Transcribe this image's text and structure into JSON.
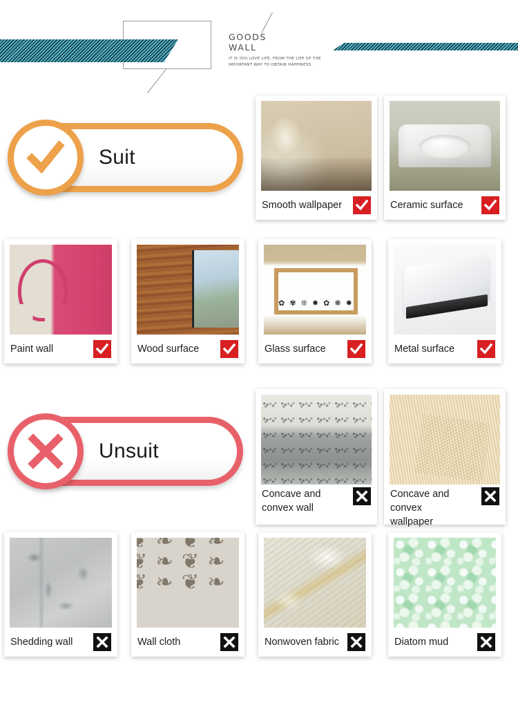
{
  "header": {
    "title_line1": "GOODS",
    "title_line2": "WALL",
    "subtitle": "IT IS YOU LOVE LIFE, FROM THE LIFE OF THE IMPORTANT WAY TO OBTAIN HAPPINESS.",
    "stripe_color": "#2b7f92"
  },
  "sections": [
    {
      "id": "suit",
      "label": "Suit",
      "icon": "check-icon",
      "accent": "#eda14a",
      "badge_type": "ok",
      "badge_glyph": "✔",
      "badge_color": "#d81f22"
    },
    {
      "id": "unsuit",
      "label": "Unsuit",
      "icon": "cross-icon",
      "accent": "#e8616a",
      "badge_type": "no",
      "badge_glyph": "✖",
      "badge_color": "#111111"
    }
  ],
  "suit_cards": [
    {
      "label": "Smooth wallpaper",
      "image": "smooth-wallpaper",
      "badge": "✔"
    },
    {
      "label": "Ceramic surface",
      "image": "ceramic-surface",
      "badge": "✔"
    },
    {
      "label": "Paint wall",
      "image": "paint-wall",
      "badge": "✔"
    },
    {
      "label": "Wood surface",
      "image": "wood-surface",
      "badge": "✔"
    },
    {
      "label": "Glass surface",
      "image": "glass-surface",
      "badge": "✔"
    },
    {
      "label": "Metal surface",
      "image": "metal-surface",
      "badge": "✔"
    }
  ],
  "unsuit_cards": [
    {
      "label": "Concave and convex wall",
      "image": "concave-convex-wall",
      "badge": "✖"
    },
    {
      "label": "Concave and convex wallpaper",
      "image": "concave-convex-wallpaper",
      "badge": "✖"
    },
    {
      "label": "Shedding wall",
      "image": "shedding-wall",
      "badge": "✖"
    },
    {
      "label": "Wall cloth",
      "image": "wall-cloth",
      "badge": "✖"
    },
    {
      "label": "Nonwoven fabric",
      "image": "nonwoven-fabric",
      "badge": "✖"
    },
    {
      "label": "Diatom mud",
      "image": "diatom-mud",
      "badge": "✖"
    }
  ]
}
